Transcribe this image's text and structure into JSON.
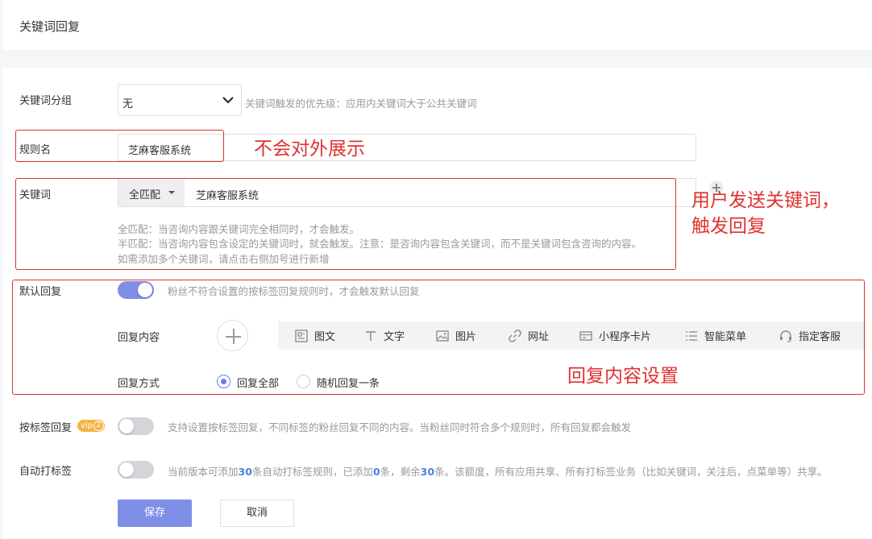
{
  "header": {
    "title": "关键词回复"
  },
  "keyword_group": {
    "label": "关键词分组",
    "selected": "无",
    "hint": "关键词触发的优先级：应用内关键词大于公共关键词"
  },
  "rule_name": {
    "label": "规则名",
    "value": "芝麻客服系统"
  },
  "keyword": {
    "label": "关键词",
    "match_mode": "全匹配",
    "value": "芝麻客服系统",
    "hints": [
      "全匹配：当咨询内容跟关键词完全相同时，才会触发。",
      "半匹配：当咨询内容包含设定的关键词时，就会触发。注意：是咨询内容包含关键词，而不是关键词包含咨询的内容。",
      "如需添加多个关键词，请点击右侧加号进行新增"
    ]
  },
  "default_reply": {
    "label": "默认回复",
    "enabled": true,
    "hint": "粉丝不符合设置的按标签回复规则时，才会触发默认回复",
    "content_label": "回复内容",
    "types": [
      {
        "label": "图文",
        "icon": "news-icon"
      },
      {
        "label": "文字",
        "icon": "text-icon"
      },
      {
        "label": "图片",
        "icon": "image-icon"
      },
      {
        "label": "网址",
        "icon": "link-icon"
      },
      {
        "label": "小程序卡片",
        "icon": "miniprogram-card-icon"
      },
      {
        "label": "智能菜单",
        "icon": "menu-list-icon"
      },
      {
        "label": "指定客服",
        "icon": "headset-icon"
      }
    ],
    "mode_label": "回复方式",
    "modes": [
      {
        "label": "回复全部",
        "checked": true
      },
      {
        "label": "随机回复一条",
        "checked": false
      }
    ]
  },
  "tag_reply": {
    "label": "按标签回复",
    "badge": "vip",
    "badge_num": "2",
    "enabled": false,
    "hint": "支持设置按标签回复，不同标签的粉丝回复不同的内容。当粉丝同时符合多个规则时，所有回复都会触发"
  },
  "auto_tag": {
    "label": "自动打标签",
    "enabled": false,
    "hint_parts": [
      "当前版本可添加",
      "30",
      "条自动打标签规则，已添加",
      "0",
      "条，剩余",
      "30",
      "条。该额度，所有应用共享、所有打标签业务（比如关键词，关注后，点菜单等）共享。"
    ]
  },
  "buttons": {
    "save": "保存",
    "cancel": "取消"
  },
  "annotations": {
    "rule_name_note": "不会对外展示",
    "keyword_note_line1": "用户发送关键词，",
    "keyword_note_line2": "触发回复",
    "reply_note": "回复内容设置"
  },
  "colors": {
    "primary": "#7f8ee6",
    "annotation": "#e03131",
    "highlight": "#4c82e0"
  }
}
